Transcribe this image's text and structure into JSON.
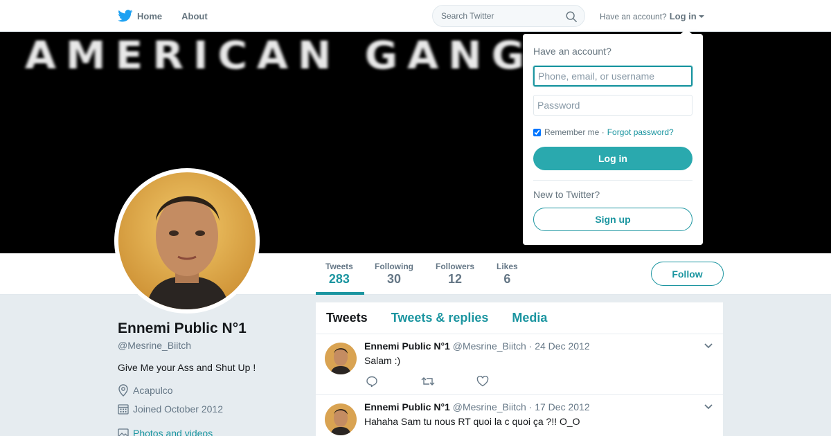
{
  "nav": {
    "home_label": "Home",
    "about_label": "About",
    "search_placeholder": "Search Twitter",
    "account_prompt": "Have an account?",
    "login_label": "Log in"
  },
  "banner": {
    "text": "AMERICAN   GANGSTER"
  },
  "profile": {
    "name": "Ennemi Public N°1",
    "handle": "@Mesrine_Biitch",
    "bio": "Give Me your Ass and Shut Up !",
    "location": "Acapulco",
    "joined": "Joined October 2012",
    "photos_link": "Photos and videos"
  },
  "stats": [
    {
      "label": "Tweets",
      "value": "283"
    },
    {
      "label": "Following",
      "value": "30"
    },
    {
      "label": "Followers",
      "value": "12"
    },
    {
      "label": "Likes",
      "value": "6"
    }
  ],
  "follow_label": "Follow",
  "timeline": {
    "tabs": [
      "Tweets",
      "Tweets & replies",
      "Media"
    ],
    "tweets": [
      {
        "name": "Ennemi Public N°1",
        "handle": "@Mesrine_Biitch",
        "date": "· 24 Dec 2012",
        "text": "Salam :)"
      },
      {
        "name": "Ennemi Public N°1",
        "handle": "@Mesrine_Biitch",
        "date": "· 17 Dec 2012",
        "text": "Hahaha Sam tu nous RT quoi la c quoi ça ?!! O_O"
      }
    ]
  },
  "login_dropdown": {
    "title": "Have an account?",
    "username_placeholder": "Phone, email, or username",
    "password_placeholder": "Password",
    "remember_label": "Remember me ·",
    "forgot_label": "Forgot password?",
    "login_button": "Log in",
    "new_prompt": "New to Twitter?",
    "signup_button": "Sign up"
  },
  "colors": {
    "accent": "#1b95a0",
    "login_button": "#2aa9ae",
    "background": "#e6ecf0"
  }
}
